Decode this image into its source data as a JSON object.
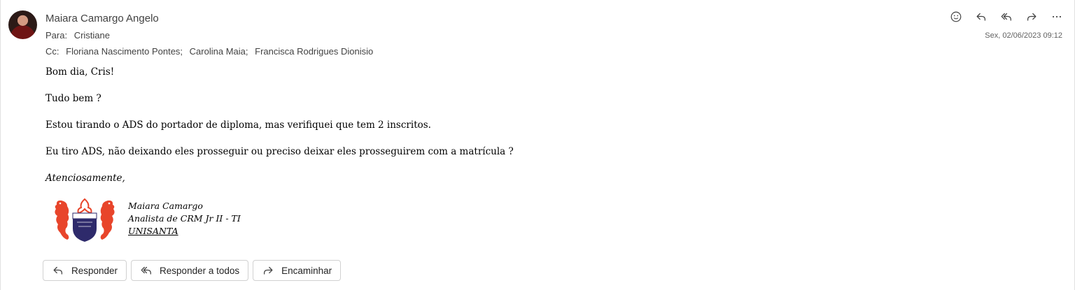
{
  "email": {
    "sender": "Maiara Camargo Angelo",
    "to_label": "Para:",
    "to": "Cristiane",
    "cc_label": "Cc:",
    "cc": [
      "Floriana Nascimento Pontes;",
      "Carolina Maia;",
      "Francisca Rodrigues Dionisio"
    ],
    "date": "Sex, 02/06/2023 09:12"
  },
  "body": {
    "greeting": "Bom dia, Cris!",
    "line2": "Tudo bem ?",
    "line3": "Estou tirando o ADS do portador de diploma, mas verifiquei que tem 2 inscritos.",
    "line4": "Eu tiro ADS, não deixando eles prosseguir ou preciso deixar eles prosseguirem com a matrícula ?",
    "closing": "Atenciosamente,"
  },
  "signature": {
    "name": "Maiara Camargo",
    "title": "Analista de CRM Jr II - TI",
    "org": "UNISANTA",
    "logo_text": "UNISANTA"
  },
  "buttons": {
    "reply": "Responder",
    "reply_all": "Responder a todos",
    "forward": "Encaminhar"
  },
  "icons": [
    "emoji-icon",
    "reply-icon",
    "reply-all-icon",
    "forward-icon",
    "more-icon"
  ],
  "colors": {
    "logo_red": "#e8452b",
    "logo_navy": "#2e2a6b"
  }
}
